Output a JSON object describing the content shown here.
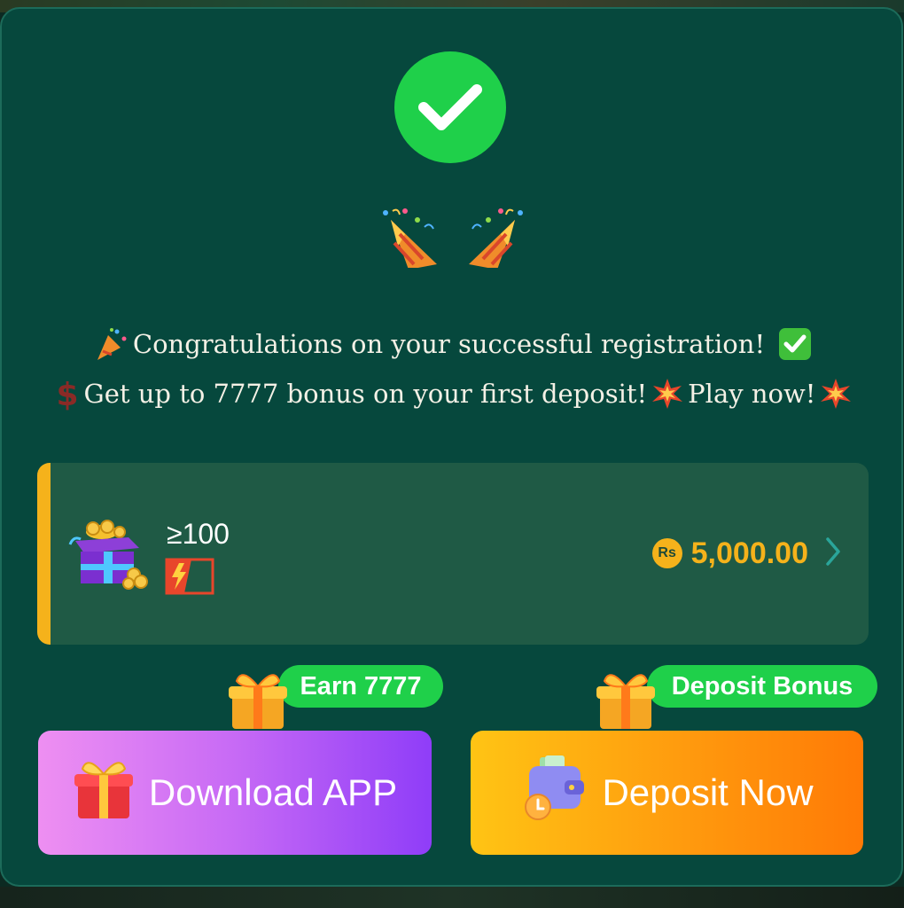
{
  "message": {
    "line1": "Congratulations on your successful registration!",
    "line2_a": "Get up to 7777 bonus on your first deposit!",
    "line2_b": "Play now!"
  },
  "bonus_card": {
    "threshold": "≥100",
    "currency_badge": "Rs",
    "amount": "5,000.00",
    "accent_color": "#f5b21b"
  },
  "badges": {
    "earn": "Earn 7777",
    "deposit_bonus": "Deposit Bonus"
  },
  "buttons": {
    "download": "Download APP",
    "deposit": "Deposit Now"
  },
  "icons": [
    "check-icon",
    "party-popper-icon",
    "white-check-emoji-icon",
    "money-sign-emoji-icon",
    "collision-emoji-icon",
    "treasure-box-icon",
    "lightning-battery-icon",
    "rupee-icon",
    "chevron-right-icon",
    "gift-icon",
    "wallet-icon"
  ],
  "colors": {
    "modal_bg": "#06483d",
    "success_green": "#1fd04a",
    "gold": "#f5b21b",
    "download_gradient": [
      "#ee8ff2",
      "#8f3df8"
    ],
    "deposit_gradient": [
      "#ffc414",
      "#ff7a06"
    ]
  }
}
